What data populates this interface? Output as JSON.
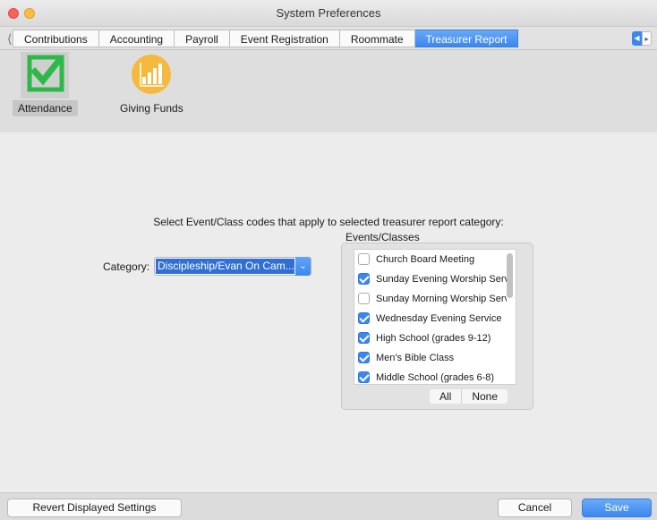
{
  "window": {
    "title": "System Preferences"
  },
  "tabs": [
    {
      "label": "Contributions",
      "active": false
    },
    {
      "label": "Accounting",
      "active": false
    },
    {
      "label": "Payroll",
      "active": false
    },
    {
      "label": "Event Registration",
      "active": false
    },
    {
      "label": "Roommate",
      "active": false
    },
    {
      "label": "Treasurer Report",
      "active": true
    }
  ],
  "toolbar": {
    "items": [
      {
        "label": "Attendance",
        "icon": "checkmark-icon",
        "selected": true,
        "color": "#2fb84a"
      },
      {
        "label": "Giving Funds",
        "icon": "bar-chart-icon",
        "selected": false,
        "color": "#f5b93d"
      }
    ]
  },
  "content": {
    "instruction": "Select Event/Class codes that apply to selected treasurer report category:",
    "events_label": "Events/Classes",
    "category_label": "Category:",
    "category_value": "Discipleship/Evan On Cam...",
    "events": [
      {
        "label": "Church Board Meeting",
        "checked": false
      },
      {
        "label": "Sunday Evening Worship Serv",
        "checked": true
      },
      {
        "label": "Sunday Morning Worship Serv",
        "checked": false
      },
      {
        "label": "Wednesday Evening Service",
        "checked": true
      },
      {
        "label": "High School (grades 9-12)",
        "checked": true
      },
      {
        "label": "Men's Bible Class",
        "checked": true
      },
      {
        "label": "Middle School (grades 6-8)",
        "checked": true
      }
    ],
    "all_label": "All",
    "none_label": "None"
  },
  "footer": {
    "revert_label": "Revert Displayed Settings",
    "cancel_label": "Cancel",
    "save_label": "Save"
  },
  "colors": {
    "accent": "#3b87f0",
    "selection": "#2f6fd6"
  }
}
